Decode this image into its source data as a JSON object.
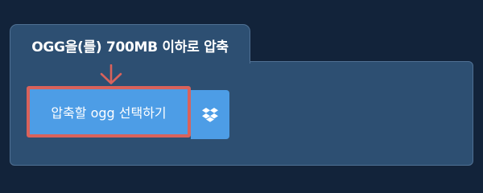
{
  "panel": {
    "title": "OGG을(를) 700MB 이하로 압축"
  },
  "select_button": {
    "label": "압축할 ogg 선택하기"
  },
  "dropbox_button": {
    "icon": "dropbox-icon"
  },
  "indicator": {
    "icon": "arrow-down-icon",
    "color": "#d9625b"
  },
  "colors": {
    "page_background": "#12233a",
    "panel_background": "#2d4f72",
    "button_background": "#4d9de6",
    "highlight_border": "#d9625b"
  }
}
